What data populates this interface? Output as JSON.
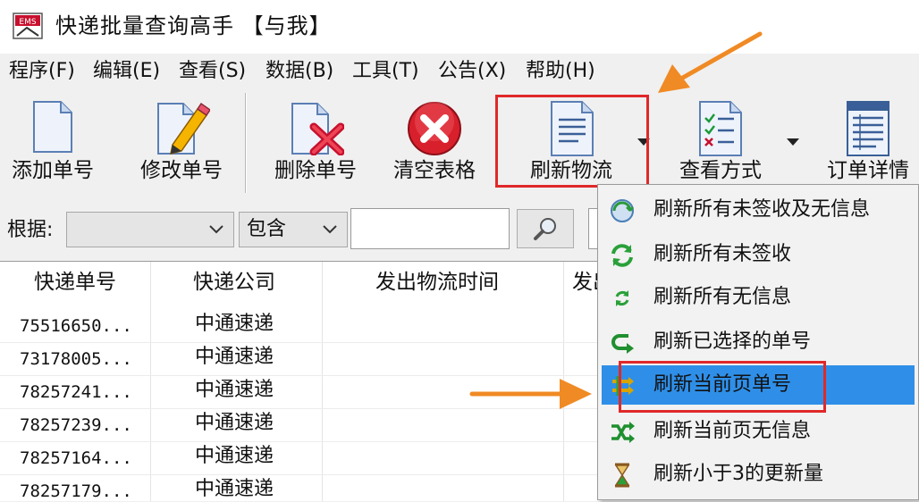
{
  "window": {
    "title": "快递批量查询高手 【与我】"
  },
  "menu": [
    "程序(F)",
    "编辑(E)",
    "查看(S)",
    "数据(B)",
    "工具(T)",
    "公告(X)",
    "帮助(H)"
  ],
  "toolbar": {
    "add": "添加单号",
    "edit": "修改单号",
    "delete": "删除单号",
    "clear": "清空表格",
    "refresh": "刷新物流",
    "view": "查看方式",
    "detail": "订单详情"
  },
  "filter": {
    "label": "根据:",
    "field_value": "",
    "match_value": "包含",
    "query_value": ""
  },
  "table": {
    "headers": [
      "快递单号",
      "快递公司",
      "发出物流时间",
      "发出"
    ],
    "rows": [
      [
        "75516650...",
        "中通速递"
      ],
      [
        "73178005...",
        "中通速递"
      ],
      [
        "78257241...",
        "中通速递"
      ],
      [
        "78257239...",
        "中通速递"
      ],
      [
        "78257164...",
        "中通速递"
      ],
      [
        "78257179...",
        "中通速递"
      ]
    ]
  },
  "refresh_menu": {
    "items": [
      {
        "label": "刷新所有未签收及无信息",
        "icon": "globe-refresh-icon"
      },
      {
        "label": "刷新所有未签收",
        "icon": "green-cycle-icon"
      },
      {
        "label": "刷新所有无信息",
        "icon": "small-cycle-icon"
      },
      {
        "label": "刷新已选择的单号",
        "icon": "return-arrow-icon"
      },
      {
        "label": "刷新当前页单号",
        "icon": "page-refresh-icon",
        "selected": true
      },
      {
        "label": "刷新当前页无信息",
        "icon": "shuffle-icon"
      },
      {
        "label": "刷新小于3的更新量",
        "icon": "hourglass-icon"
      }
    ]
  },
  "colors": {
    "highlight": "#e0282a",
    "annotation_arrow": "#f08a24",
    "selection": "#2f8fe8"
  }
}
